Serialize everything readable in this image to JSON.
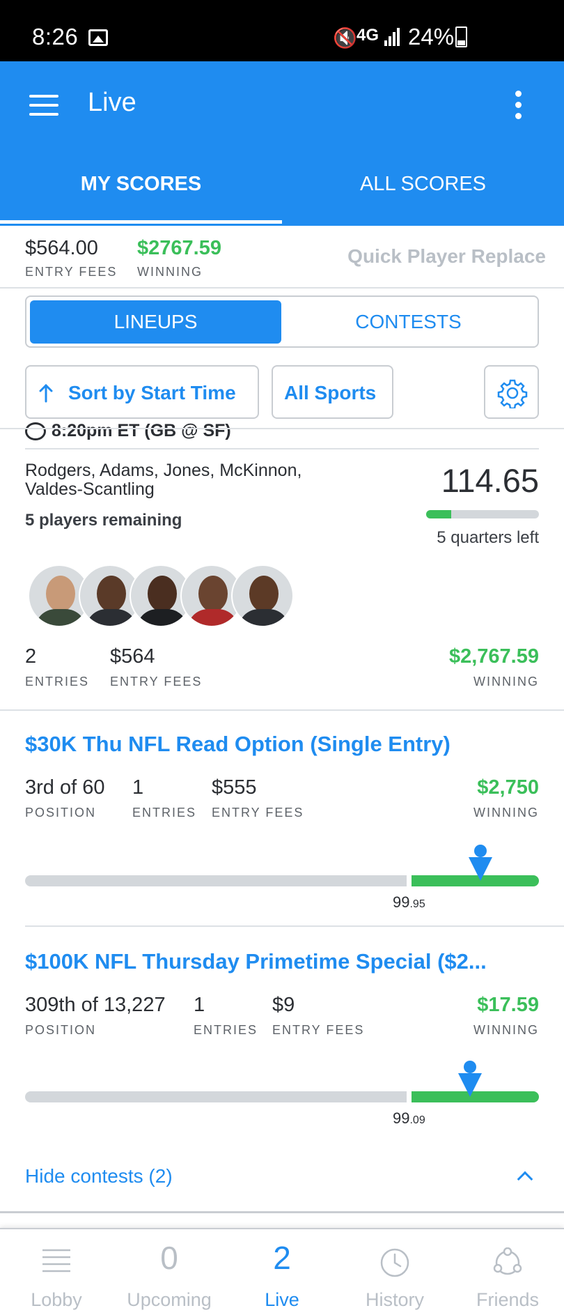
{
  "status_bar": {
    "time": "8:26",
    "network": "4G",
    "battery": "24%"
  },
  "app_bar": {
    "title": "Live"
  },
  "tabs": [
    {
      "label": "MY SCORES",
      "active": true
    },
    {
      "label": "ALL SCORES",
      "active": false
    }
  ],
  "summary": {
    "entry_fees": "$564.00",
    "entry_fees_label": "ENTRY FEES",
    "winning": "$2767.59",
    "winning_label": "WINNING",
    "quick_replace": "Quick Player Replace"
  },
  "segment": {
    "lineups": "LINEUPS",
    "contests": "CONTESTS",
    "selected": "LINEUPS"
  },
  "filters": {
    "sort": "Sort by Start Time",
    "sports": "All Sports"
  },
  "lineup": {
    "game": "8:20pm ET (GB @ SF)",
    "players_text": "Rodgers, Adams, Jones, McKinnon, Valdes-Scantling",
    "players_remaining": "5 players remaining",
    "score": "114.65",
    "progress": 0.22,
    "quarters_left": "5 quarters left",
    "entries": "2",
    "entries_label": "ENTRIES",
    "entry_fees": "$564",
    "entry_fees_label": "ENTRY FEES",
    "winning": "$2,767.59",
    "winning_label": "WINNING"
  },
  "contests": [
    {
      "title": "$30K Thu NFL Read Option (Single Entry)",
      "position": "3rd of 60",
      "position_label": "POSITION",
      "entries": "1",
      "entries_label": "ENTRIES",
      "entry_fees": "$555",
      "entry_fees_label": "ENTRY FEES",
      "winning": "$2,750",
      "winning_label": "WINNING",
      "percentile": "99",
      "percentile_decimal": ".95"
    },
    {
      "title": "$100K NFL Thursday Primetime Special ($2...",
      "position": "309th of 13,227",
      "position_label": "POSITION",
      "entries": "1",
      "entries_label": "ENTRIES",
      "entry_fees": "$9",
      "entry_fees_label": "ENTRY FEES",
      "winning": "$17.59",
      "winning_label": "WINNING",
      "percentile": "99",
      "percentile_decimal": ".09"
    }
  ],
  "hide_contests": "Hide contests (2)",
  "bottom_nav": [
    {
      "label": "Lobby",
      "icon": "lobby-icon"
    },
    {
      "label": "Upcoming",
      "count": "0"
    },
    {
      "label": "Live",
      "count": "2",
      "active": true
    },
    {
      "label": "History",
      "icon": "clock-icon"
    },
    {
      "label": "Friends",
      "icon": "friends-icon"
    }
  ],
  "colors": {
    "primary": "#1f8cf0",
    "green": "#3bbf5a",
    "grey": "#d3d7db"
  }
}
